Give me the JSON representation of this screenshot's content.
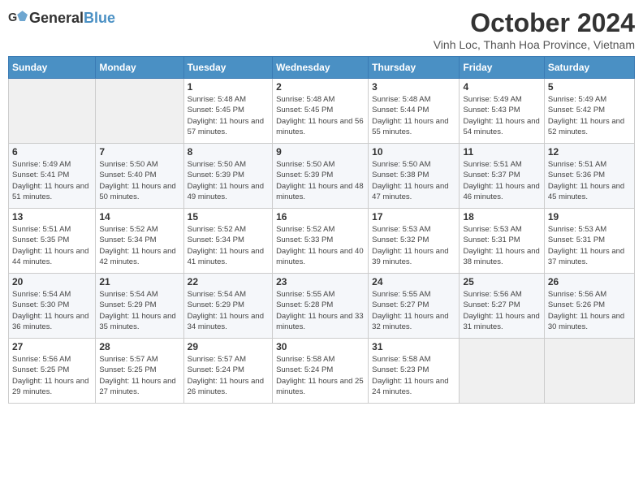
{
  "logo": {
    "general": "General",
    "blue": "Blue"
  },
  "header": {
    "month_title": "October 2024",
    "subtitle": "Vinh Loc, Thanh Hoa Province, Vietnam"
  },
  "weekdays": [
    "Sunday",
    "Monday",
    "Tuesday",
    "Wednesday",
    "Thursday",
    "Friday",
    "Saturday"
  ],
  "weeks": [
    [
      {
        "day": "",
        "info": ""
      },
      {
        "day": "",
        "info": ""
      },
      {
        "day": "1",
        "info": "Sunrise: 5:48 AM\nSunset: 5:45 PM\nDaylight: 11 hours and 57 minutes."
      },
      {
        "day": "2",
        "info": "Sunrise: 5:48 AM\nSunset: 5:45 PM\nDaylight: 11 hours and 56 minutes."
      },
      {
        "day": "3",
        "info": "Sunrise: 5:48 AM\nSunset: 5:44 PM\nDaylight: 11 hours and 55 minutes."
      },
      {
        "day": "4",
        "info": "Sunrise: 5:49 AM\nSunset: 5:43 PM\nDaylight: 11 hours and 54 minutes."
      },
      {
        "day": "5",
        "info": "Sunrise: 5:49 AM\nSunset: 5:42 PM\nDaylight: 11 hours and 52 minutes."
      }
    ],
    [
      {
        "day": "6",
        "info": "Sunrise: 5:49 AM\nSunset: 5:41 PM\nDaylight: 11 hours and 51 minutes."
      },
      {
        "day": "7",
        "info": "Sunrise: 5:50 AM\nSunset: 5:40 PM\nDaylight: 11 hours and 50 minutes."
      },
      {
        "day": "8",
        "info": "Sunrise: 5:50 AM\nSunset: 5:39 PM\nDaylight: 11 hours and 49 minutes."
      },
      {
        "day": "9",
        "info": "Sunrise: 5:50 AM\nSunset: 5:39 PM\nDaylight: 11 hours and 48 minutes."
      },
      {
        "day": "10",
        "info": "Sunrise: 5:50 AM\nSunset: 5:38 PM\nDaylight: 11 hours and 47 minutes."
      },
      {
        "day": "11",
        "info": "Sunrise: 5:51 AM\nSunset: 5:37 PM\nDaylight: 11 hours and 46 minutes."
      },
      {
        "day": "12",
        "info": "Sunrise: 5:51 AM\nSunset: 5:36 PM\nDaylight: 11 hours and 45 minutes."
      }
    ],
    [
      {
        "day": "13",
        "info": "Sunrise: 5:51 AM\nSunset: 5:35 PM\nDaylight: 11 hours and 44 minutes."
      },
      {
        "day": "14",
        "info": "Sunrise: 5:52 AM\nSunset: 5:34 PM\nDaylight: 11 hours and 42 minutes."
      },
      {
        "day": "15",
        "info": "Sunrise: 5:52 AM\nSunset: 5:34 PM\nDaylight: 11 hours and 41 minutes."
      },
      {
        "day": "16",
        "info": "Sunrise: 5:52 AM\nSunset: 5:33 PM\nDaylight: 11 hours and 40 minutes."
      },
      {
        "day": "17",
        "info": "Sunrise: 5:53 AM\nSunset: 5:32 PM\nDaylight: 11 hours and 39 minutes."
      },
      {
        "day": "18",
        "info": "Sunrise: 5:53 AM\nSunset: 5:31 PM\nDaylight: 11 hours and 38 minutes."
      },
      {
        "day": "19",
        "info": "Sunrise: 5:53 AM\nSunset: 5:31 PM\nDaylight: 11 hours and 37 minutes."
      }
    ],
    [
      {
        "day": "20",
        "info": "Sunrise: 5:54 AM\nSunset: 5:30 PM\nDaylight: 11 hours and 36 minutes."
      },
      {
        "day": "21",
        "info": "Sunrise: 5:54 AM\nSunset: 5:29 PM\nDaylight: 11 hours and 35 minutes."
      },
      {
        "day": "22",
        "info": "Sunrise: 5:54 AM\nSunset: 5:29 PM\nDaylight: 11 hours and 34 minutes."
      },
      {
        "day": "23",
        "info": "Sunrise: 5:55 AM\nSunset: 5:28 PM\nDaylight: 11 hours and 33 minutes."
      },
      {
        "day": "24",
        "info": "Sunrise: 5:55 AM\nSunset: 5:27 PM\nDaylight: 11 hours and 32 minutes."
      },
      {
        "day": "25",
        "info": "Sunrise: 5:56 AM\nSunset: 5:27 PM\nDaylight: 11 hours and 31 minutes."
      },
      {
        "day": "26",
        "info": "Sunrise: 5:56 AM\nSunset: 5:26 PM\nDaylight: 11 hours and 30 minutes."
      }
    ],
    [
      {
        "day": "27",
        "info": "Sunrise: 5:56 AM\nSunset: 5:25 PM\nDaylight: 11 hours and 29 minutes."
      },
      {
        "day": "28",
        "info": "Sunrise: 5:57 AM\nSunset: 5:25 PM\nDaylight: 11 hours and 27 minutes."
      },
      {
        "day": "29",
        "info": "Sunrise: 5:57 AM\nSunset: 5:24 PM\nDaylight: 11 hours and 26 minutes."
      },
      {
        "day": "30",
        "info": "Sunrise: 5:58 AM\nSunset: 5:24 PM\nDaylight: 11 hours and 25 minutes."
      },
      {
        "day": "31",
        "info": "Sunrise: 5:58 AM\nSunset: 5:23 PM\nDaylight: 11 hours and 24 minutes."
      },
      {
        "day": "",
        "info": ""
      },
      {
        "day": "",
        "info": ""
      }
    ]
  ]
}
